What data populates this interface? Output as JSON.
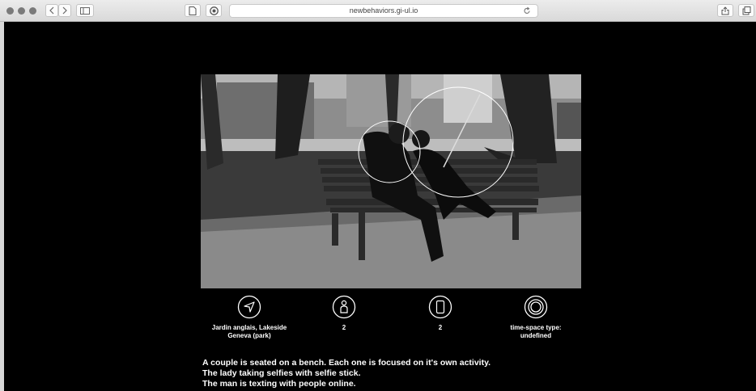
{
  "browser": {
    "url": "newbehaviors.gi-ul.io"
  },
  "photo": {
    "alt": "Black and white photo of a couple seated on a park bench"
  },
  "info": [
    {
      "icon": "location-arrow-icon",
      "label": "Jardin anglais, Lakeside\nGeneva (park)"
    },
    {
      "icon": "person-icon",
      "label": "2"
    },
    {
      "icon": "smartphone-icon",
      "label": "2"
    },
    {
      "icon": "concentric-circles-icon",
      "label": "time-space type:\nundefined"
    }
  ],
  "description": [
    "A couple is seated on a bench. Each one is focused on it's own activity.",
    "The lady taking selfies with selfie stick.",
    "The man is texting with people online."
  ]
}
